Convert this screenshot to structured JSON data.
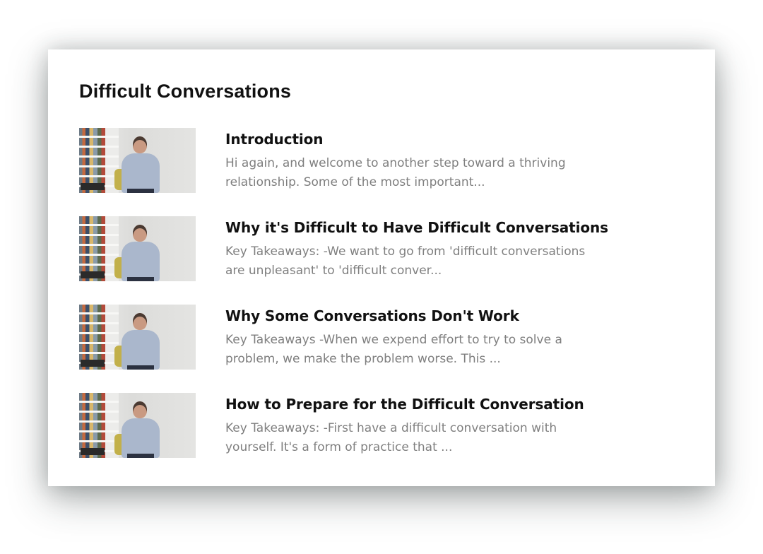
{
  "course": {
    "title": "Difficult Conversations"
  },
  "lessons": [
    {
      "title": "Introduction",
      "description": "Hi again, and welcome to another step toward a thriving relationship. Some of the most important..."
    },
    {
      "title": "Why it's Difficult to Have Difficult Conversations",
      "description": "Key Takeaways: -We want to go from 'difficult conversations are unpleasant' to 'difficult conver..."
    },
    {
      "title": "Why Some Conversations Don't Work",
      "description": "Key Takeaways -When we expend effort to try to solve a problem, we make the problem worse. This ..."
    },
    {
      "title": "How to Prepare for the Difficult Conversation",
      "description": "Key Takeaways: -First have a difficult conversation with yourself. It's a form of practice that ..."
    }
  ]
}
